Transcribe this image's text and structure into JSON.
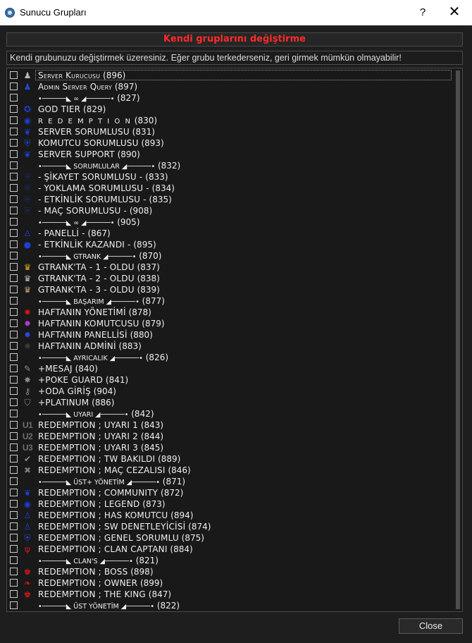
{
  "window": {
    "title": "Sunucu Grupları",
    "help_label": "?",
    "close_label": "✕"
  },
  "banner": "Kendi gruplarını değiştirme",
  "warning": "Kendi grubunuzu değiştirmek üzeresiniz. Eğer grubu terkederseniz, geri girmek mümkün olmayabilir!",
  "close_button": "Close",
  "colors": {
    "banner_red": "#ff2b2b",
    "accent_blue": "#1c3fd6",
    "accent_red": "#d01515",
    "gold": "#d9a21b"
  },
  "groups": [
    {
      "label": "Server Kurucusu",
      "id": "(896)",
      "icon": "person-silhouette",
      "style": "sc"
    },
    {
      "label": "Admin Server Query",
      "id": "(897)",
      "icon": "person-blue",
      "style": "sc"
    },
    {
      "label": "•──────◣ ∞ ◢──────•",
      "id": "(827)",
      "icon": "",
      "style": "sep"
    },
    {
      "label": "GOD TIER",
      "id": "(829)",
      "icon": "star-badge",
      "style": "sc"
    },
    {
      "label": "R E D E M P T I O N",
      "id": "(830)",
      "icon": "circle-emblem",
      "style": "w"
    },
    {
      "label": "SERVER SORUMLUSU",
      "id": "(831)",
      "icon": "wing-badge",
      "style": "sc"
    },
    {
      "label": "KOMUTCU SORUMLUSU",
      "id": "(893)",
      "icon": "shield-emblem",
      "style": "sc"
    },
    {
      "label": "SERVER SUPPORT",
      "id": "(890)",
      "icon": "wing-badge",
      "style": "sc"
    },
    {
      "label": "•──────◣ SORUMLULAR ◢──────•",
      "id": "(832)",
      "icon": "",
      "style": "sep"
    },
    {
      "label": "- ŞİKAYET SORUMLUSU -",
      "id": "(833)",
      "icon": "faint-shield",
      "style": "sc"
    },
    {
      "label": "- YOKLAMA SORUMLUSU -",
      "id": "(834)",
      "icon": "faint-shield",
      "style": "sc"
    },
    {
      "label": "- ETKİNLİK SORUMLUSU -",
      "id": "(835)",
      "icon": "faint-shield",
      "style": "sc"
    },
    {
      "label": "- MAÇ SORUMLUSU -",
      "id": "(908)",
      "icon": "faint-shield",
      "style": "sc"
    },
    {
      "label": "•──────◣ ∞ ◢──────•",
      "id": "(905)",
      "icon": "",
      "style": "sep"
    },
    {
      "label": "- PANELLİ -",
      "id": "(867)",
      "icon": "figure-blue",
      "style": "sc"
    },
    {
      "label": "- ETKİNLİK KAZANDI -",
      "id": "(895)",
      "icon": "round-badge",
      "style": "sc"
    },
    {
      "label": "•──────◣ GTRANK ◢──────•",
      "id": "(870)",
      "icon": "",
      "style": "sep"
    },
    {
      "label": "GTRANK'TA - 1 - OLDU",
      "id": "(837)",
      "icon": "trophy-gold",
      "style": "sc"
    },
    {
      "label": "GTRANK'TA - 2 - OLDU",
      "id": "(838)",
      "icon": "trophy-silver",
      "style": "sc"
    },
    {
      "label": "GTRANK'TA - 3 - OLDU",
      "id": "(839)",
      "icon": "trophy-bronze",
      "style": "sc"
    },
    {
      "label": "•──────◣ BAŞARIM ◢──────•",
      "id": "(877)",
      "icon": "",
      "style": "sep"
    },
    {
      "label": "HAFTANIN YÖNETİMİ",
      "id": "(878)",
      "icon": "red-badge",
      "style": "sc"
    },
    {
      "label": "HAFTANIN KOMUTCUSU",
      "id": "(879)",
      "icon": "purple-badge",
      "style": "sc"
    },
    {
      "label": "HAFTANIN PANELLİSİ",
      "id": "(880)",
      "icon": "blue-badge",
      "style": "sc"
    },
    {
      "label": "HAFTANIN ADMİNİ",
      "id": "(883)",
      "icon": "dark-badge",
      "style": "sc"
    },
    {
      "label": "•──────◣ AYRICALIK ◢──────•",
      "id": "(826)",
      "icon": "",
      "style": "sep"
    },
    {
      "label": "+MESAJ",
      "id": "(840)",
      "icon": "pen-icon",
      "style": "sc"
    },
    {
      "label": "+POKE GUARD",
      "id": "(841)",
      "icon": "burst-icon",
      "style": "sc"
    },
    {
      "label": "+ODA GİRİŞ",
      "id": "(904)",
      "icon": "key-icon",
      "style": "sc"
    },
    {
      "label": "+PLATINUM",
      "id": "(886)",
      "icon": "shield-outline",
      "style": "sc"
    },
    {
      "label": "•──────◣ UYARI ◢──────•",
      "id": "(842)",
      "icon": "",
      "style": "sep"
    },
    {
      "label": "REDEMPTION ; UYARI 1",
      "id": "(843)",
      "icon": "U1",
      "style": "sc"
    },
    {
      "label": "REDEMPTION ; UYARI 2",
      "id": "(844)",
      "icon": "U2",
      "style": "sc"
    },
    {
      "label": "REDEMPTION ; UYARI 3",
      "id": "(845)",
      "icon": "U3",
      "style": "sc"
    },
    {
      "label": "REDEMPTION ; TW BAKILDI",
      "id": "(889)",
      "icon": "check-badge",
      "style": "sc"
    },
    {
      "label": "REDEMPTION ; MAÇ CEZALISI",
      "id": "(846)",
      "icon": "crossed-icon",
      "style": "sc"
    },
    {
      "label": "•──────◣ ÜST+ YÖNETİM ◢──────•",
      "id": "(871)",
      "icon": "",
      "style": "sep"
    },
    {
      "label": "REDEMPTION ; COMMUNITY",
      "id": "(872)",
      "icon": "wing-badge",
      "style": "sc"
    },
    {
      "label": "REDEMPTION ; LEGEND",
      "id": "(873)",
      "icon": "circle-emblem",
      "style": "sc"
    },
    {
      "label": "REDEMPTION ; HAS KOMUTCU",
      "id": "(894)",
      "icon": "figure-blue",
      "style": "sc"
    },
    {
      "label": "REDEMPTION ; SW DENETLEYİCİSİ",
      "id": "(874)",
      "icon": "figure-blue",
      "style": "sc"
    },
    {
      "label": "REDEMPTION ; GENEL SORUMLU",
      "id": "(875)",
      "icon": "shield-emblem",
      "style": "sc"
    },
    {
      "label": "REDEMPTION ; CLAN CAPTANI",
      "id": "(884)",
      "icon": "trident-red",
      "style": "sc"
    },
    {
      "label": "•──────◣ CLAN'S ◢──────•",
      "id": "(821)",
      "icon": "",
      "style": "sep"
    },
    {
      "label": "REDEMPTION ; BOSS",
      "id": "(898)",
      "icon": "crown-red",
      "style": "sc"
    },
    {
      "label": "REDEMPTION ; OWNER",
      "id": "(899)",
      "icon": "wing-red",
      "style": "sc"
    },
    {
      "label": "REDEMPTION ; THE KING",
      "id": "(847)",
      "icon": "crown-red",
      "style": "sc"
    },
    {
      "label": "•──────◣ ÜST YÖNETİM ◢──────•",
      "id": "(822)",
      "icon": "",
      "style": "sep"
    }
  ]
}
